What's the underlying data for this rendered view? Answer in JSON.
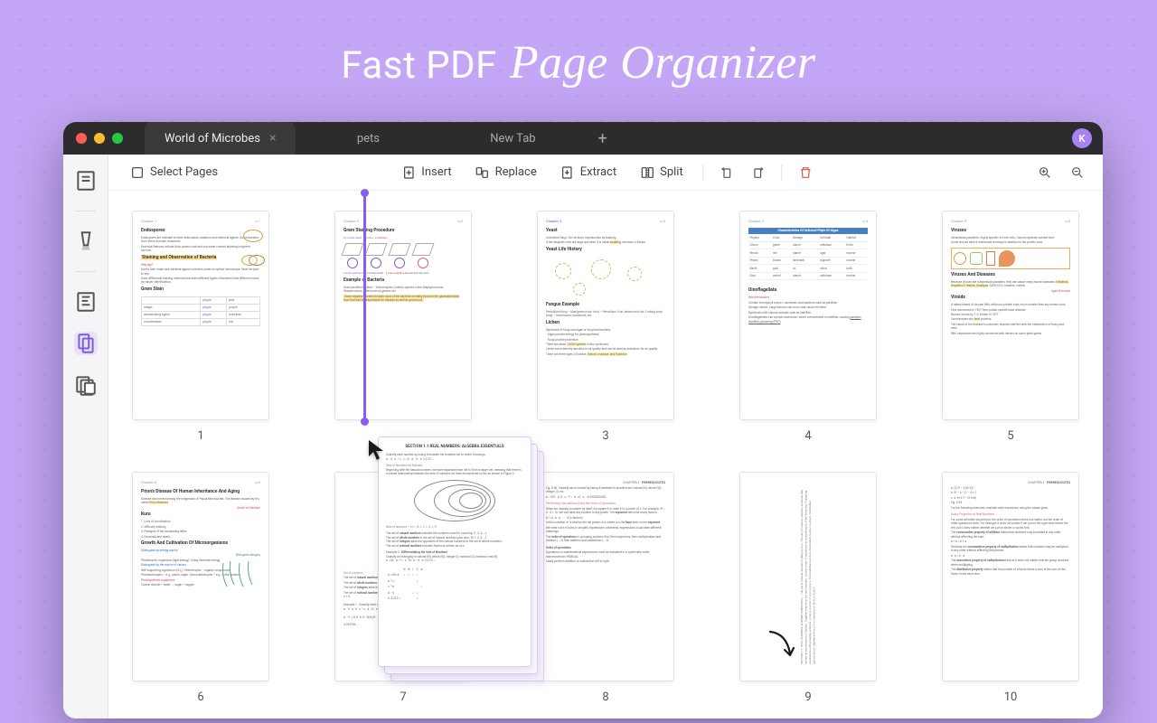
{
  "hero": {
    "plain": "Fast PDF",
    "script": "Page Organizer"
  },
  "tabs": [
    {
      "label": "World of Microbes",
      "active": true
    },
    {
      "label": "pets",
      "active": false
    },
    {
      "label": "New Tab",
      "active": false
    }
  ],
  "avatar_letter": "K",
  "toolbar": {
    "select_pages": "Select Pages",
    "insert": "Insert",
    "replace": "Replace",
    "extract": "Extract",
    "split": "Split"
  },
  "pages": [
    {
      "n": "1"
    },
    {
      "n": ""
    },
    {
      "n": "3"
    },
    {
      "n": "4"
    },
    {
      "n": "5"
    },
    {
      "n": "6"
    },
    {
      "n": "7"
    },
    {
      "n": "8"
    },
    {
      "n": "9"
    },
    {
      "n": "10"
    }
  ],
  "thumb1": {
    "chapter": "Chapter 1",
    "section": "Endospores",
    "highlight": "Staining and Observation of Bacteria",
    "why": "Why dye?",
    "gram": "Gram Stain"
  },
  "thumb2": {
    "chapter": "Chapter 2",
    "title": "Gram Staining Procedure",
    "sub": "Example of Bacteria"
  },
  "thumb3": {
    "chapter": "Chapter 3",
    "h1": "Yeast",
    "h2": "Yeast Life History",
    "h3": "Fungus Example",
    "h4": "Lichen"
  },
  "thumb4": {
    "title": "Characteristics Of Selected Phyla Of Algae",
    "sub": "Dinoflagellata"
  },
  "thumb5": {
    "chapter": "Chapter 5",
    "h1": "Viruses",
    "h2": "Viruses And Diseases",
    "h3": "Viroids"
  },
  "thumb6": {
    "chapter": "Chapter 6",
    "h1": "Prion's Disease Of Human Inheritance And Aging",
    "annot": "Seeds of infection!",
    "h2": "Kuru",
    "h3": "Growth And Cultivation Of Microorganisms",
    "green_note": "Biological category",
    "red_note": "Photosynthetic organisms"
  },
  "thumb7": {
    "h1": "REAL NUMBERS: ALGEBRA ESSENTIALS",
    "sec": "SECTION 1.1"
  },
  "thumb8": {
    "h1": "PREREQUISITES",
    "ch": "CHAPTER 1"
  },
  "thumb10": {
    "h1": "PREREQUISITES",
    "ch": "CHAPTER 1",
    "orange": "Using Properties of Real Numbers"
  },
  "drag": {
    "title": "SECTION 1.1   REAL NUMBERS: ALGEBRA ESSENTIALS"
  }
}
